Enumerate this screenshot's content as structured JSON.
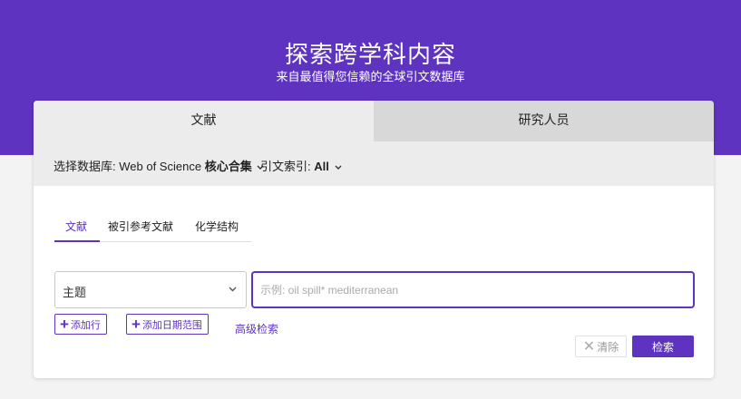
{
  "hero": {
    "title": "探索跨学科内容",
    "subtitle": "来自最值得您信赖的全球引文数据库"
  },
  "top_tabs": [
    {
      "label": "文献",
      "active": true
    },
    {
      "label": "研究人员",
      "active": false
    }
  ],
  "database_bar": {
    "database_label": "选择数据库:",
    "database_value_prefix": "Web of Science",
    "database_value_bold": "核心合集",
    "citation_index_label": "引文索引:",
    "citation_index_value": "All"
  },
  "search_tabs": [
    {
      "label": "文献",
      "active": true
    },
    {
      "label": "被引参考文献",
      "active": false
    },
    {
      "label": "化学结构",
      "active": false
    }
  ],
  "search_row": {
    "field_value": "主题",
    "input_value": "",
    "input_placeholder": "示例: oil spill* mediterranean"
  },
  "actions": {
    "add_row": "添加行",
    "add_date_range": "添加日期范围",
    "advanced_search": "高级检索",
    "clear": "清除",
    "search": "检索"
  },
  "colors": {
    "accent": "#5e33bf",
    "page_background": "#f3f3f3",
    "tab_active": "#ececec",
    "tab_inactive": "#d8d8d8"
  }
}
